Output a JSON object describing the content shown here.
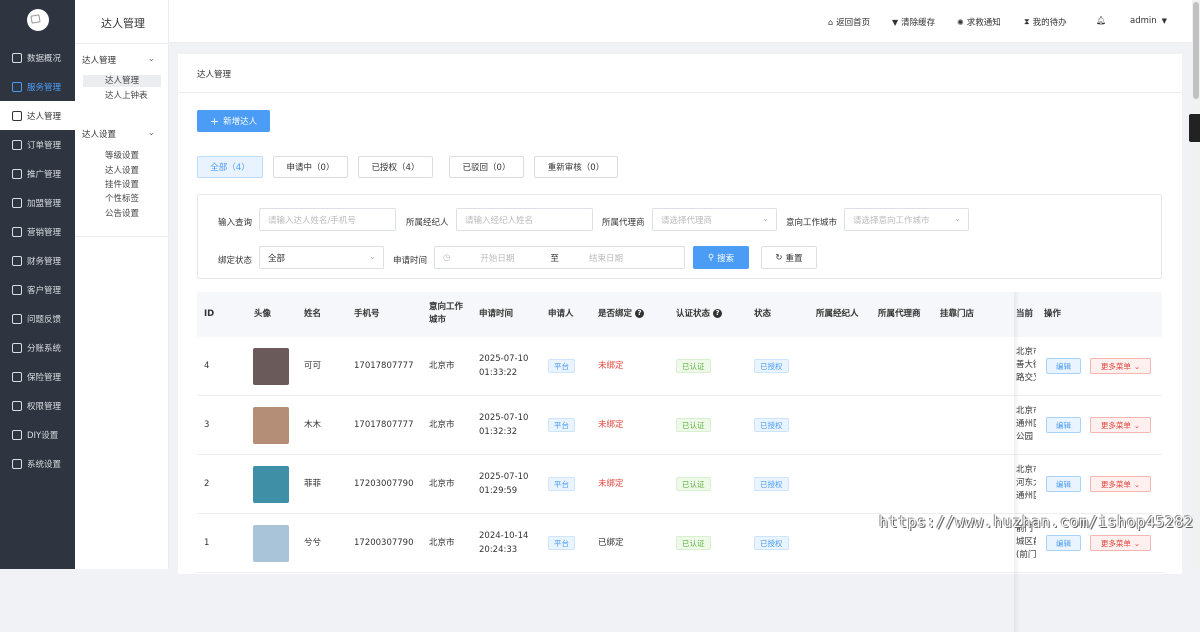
{
  "sidebar": {
    "items": [
      {
        "label": "数据概况",
        "icon": "dashboard-icon"
      },
      {
        "label": "服务管理",
        "icon": "service-icon",
        "current": true
      },
      {
        "label": "达人管理",
        "icon": "talent-icon",
        "active": true
      },
      {
        "label": "订单管理",
        "icon": "order-icon"
      },
      {
        "label": "推广管理",
        "icon": "promotion-icon"
      },
      {
        "label": "加盟管理",
        "icon": "franchise-icon"
      },
      {
        "label": "营销管理",
        "icon": "marketing-icon"
      },
      {
        "label": "财务管理",
        "icon": "finance-icon"
      },
      {
        "label": "客户管理",
        "icon": "customer-icon"
      },
      {
        "label": "问题反馈",
        "icon": "feedback-icon"
      },
      {
        "label": "分账系统",
        "icon": "split-icon"
      },
      {
        "label": "保险管理",
        "icon": "insurance-icon"
      },
      {
        "label": "权限管理",
        "icon": "permission-icon"
      },
      {
        "label": "DIY设置",
        "icon": "diy-icon"
      },
      {
        "label": "系统设置",
        "icon": "settings-icon"
      }
    ]
  },
  "subnav": {
    "title": "达人管理",
    "groups": [
      {
        "label": "达人管理",
        "items": [
          "达人管理",
          "达人上钟表"
        ]
      },
      {
        "label": "达人设置",
        "items": [
          "等级设置",
          "达人设置",
          "挂件设置",
          "个性标签",
          "公告设置"
        ]
      }
    ]
  },
  "topbar": {
    "home": "返回首页",
    "clear_cache": "清除缓存",
    "sos": "求救通知",
    "todo": "我的待办",
    "user": "admin"
  },
  "page": {
    "breadcrumb": "达人管理",
    "add_button": "新增达人",
    "tabs": [
      "全部（4）",
      "申请中（0）",
      "已授权（4）",
      "已驳回（0）",
      "重新审核（0）"
    ]
  },
  "filters": {
    "keyword_label": "输入查询",
    "keyword_placeholder": "请输入达人姓名/手机号",
    "agent_label": "所属经纪人",
    "agent_placeholder": "请输入经纪人姓名",
    "proxy_label": "所属代理商",
    "proxy_placeholder": "请选择代理商",
    "city_label": "意向工作城市",
    "city_placeholder": "请选择意向工作城市",
    "bind_label": "绑定状态",
    "bind_value": "全部",
    "time_label": "申请时间",
    "start_placeholder": "开始日期",
    "range_sep": "至",
    "end_placeholder": "结束日期",
    "search": "搜索",
    "reset": "重置"
  },
  "table": {
    "headers": [
      "ID",
      "头像",
      "姓名",
      "手机号",
      "意向工作城市",
      "申请时间",
      "申请人",
      "是否绑定",
      "认证状态",
      "状态",
      "所属经纪人",
      "所属代理商",
      "挂靠门店",
      "当前",
      "操作"
    ],
    "rows": [
      {
        "id": "4",
        "name": "可可",
        "phone": "17017807777",
        "city": "北京市",
        "date": "2025-07-10",
        "time": "01:33:22",
        "applicant": "平台",
        "bound": "未绑定",
        "cert": "已认证",
        "status": "已授权",
        "addr": [
          "北京市",
          "善大街",
          "路交叉"
        ],
        "avatar": "#6b5a5a"
      },
      {
        "id": "3",
        "name": "木木",
        "phone": "17017807777",
        "city": "北京市",
        "date": "2025-07-10",
        "time": "01:32:32",
        "applicant": "平台",
        "bound": "未绑定",
        "cert": "已认证",
        "status": "已授权",
        "addr": [
          "北京市",
          "通州区",
          "公园"
        ],
        "avatar": "#b58e78"
      },
      {
        "id": "2",
        "name": "菲菲",
        "phone": "17203007790",
        "city": "北京市",
        "date": "2025-07-10",
        "time": "01:29:59",
        "applicant": "平台",
        "bound": "未绑定",
        "cert": "已认证",
        "status": "已授权",
        "addr": [
          "北京市",
          "河东大",
          "通州区"
        ],
        "avatar": "#3f8fa6"
      },
      {
        "id": "1",
        "name": "兮兮",
        "phone": "17200307790",
        "city": "北京市",
        "date": "2024-10-14",
        "time": "20:24:33",
        "applicant": "平台",
        "bound": "已绑定",
        "cert": "已认证",
        "status": "已授权",
        "addr": [
          "前门",
          "城区前",
          "(前门"
        ],
        "avatar": "#a9c4d8"
      }
    ],
    "edit": "编辑",
    "more": "更多菜单"
  },
  "watermark": "https://www.huzhan.com/ishop45282"
}
